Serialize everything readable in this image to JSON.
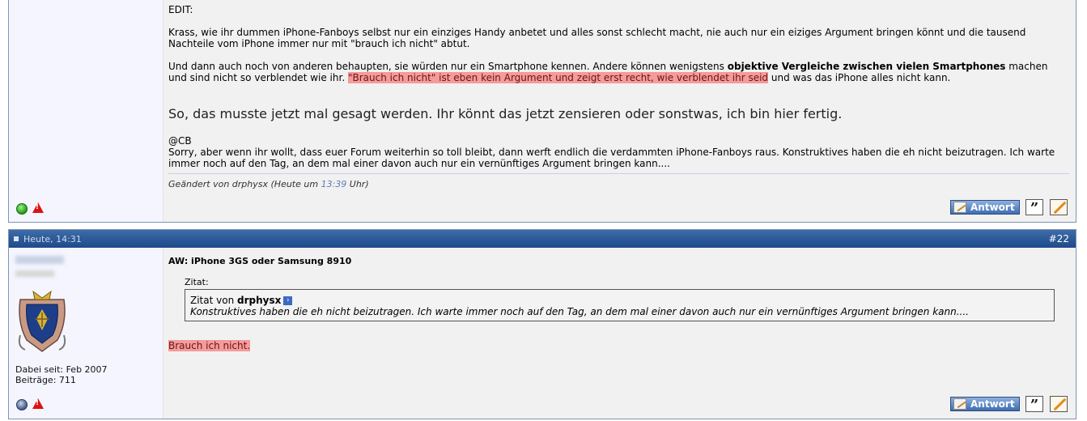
{
  "post1": {
    "edit_label": "EDIT:",
    "para1": "Krass, wie ihr dummen iPhone-Fanboys selbst nur ein einziges Handy anbetet und alles sonst schlecht macht, nie auch nur ein eiziges Argument bringen könnt und die tausend Nachteile vom iPhone immer nur mit \"brauch ich nicht\" abtut.",
    "para2_a": "Und dann auch noch von anderen behaupten, sie würden nur ein Smartphone kennen. Andere können wenigstens ",
    "para2_bold": "objektive Vergleiche zwischen vielen Smartphones",
    "para2_b": " machen und sind nicht so verblendet wie ihr. ",
    "para2_hl": "\"Brauch ich nicht\" ist eben kein Argument und zeigt erst recht, wie verblendet ihr seid",
    "para2_c": " und was das iPhone alles nicht kann.",
    "big_text": "So, das musste jetzt mal gesagt werden. Ihr könnt das jetzt zensieren oder sonstwas, ich bin hier fertig.",
    "at_cb": "@CB",
    "para3": "Sorry, aber wenn ihr wollt, dass euer Forum weiterhin so toll bleibt, dann werft endlich die verdammten iPhone-Fanboys raus. Konstruktives haben die eh nicht beizutragen. Ich warte immer noch auf den Tag, an dem mal einer davon auch nur ein vernünftiges Argument bringen kann....",
    "edited_prefix": "Geändert von drphysx (Heute um ",
    "edited_time": "13:39",
    "edited_suffix": " Uhr)",
    "reply_label": "Antwort"
  },
  "post2": {
    "date": "Heute, 14:31",
    "number": "#22",
    "title": "AW: iPhone 3GS oder Samsung 8910",
    "quote_label": "Zitat:",
    "quote_from": "Zitat von ",
    "quote_author": "drphysx",
    "quote_arrow": "›",
    "quote_text": "Konstruktives haben die eh nicht beizutragen. Ich warte immer noch auf den Tag, an dem mal einer davon auch nur ein vernünftiges Argument bringen kann....",
    "reply_text": "Brauch ich nicht.",
    "joined": "Dabei seit: Feb 2007",
    "posts": "Beiträge: 711",
    "reply_label": "Antwort"
  },
  "icons": {
    "quote_glyph": "”",
    "online_status": "online-icon",
    "offline_status": "offline-icon",
    "report": "warning-icon"
  },
  "colors": {
    "highlight": "#f49b9b",
    "titlebar": "#1e4a89",
    "online": "#1f9a12"
  }
}
